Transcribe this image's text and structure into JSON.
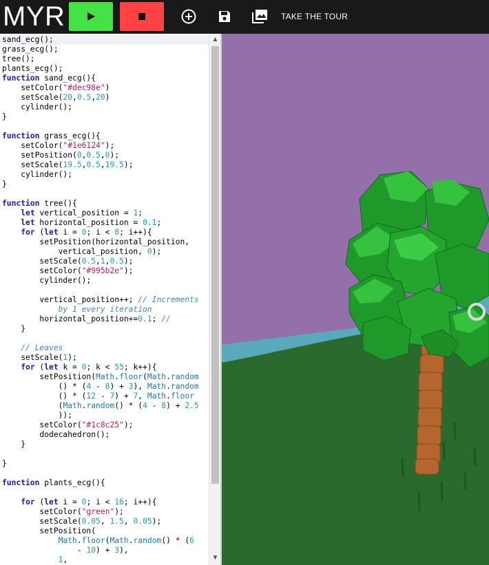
{
  "app": {
    "logo": "MYR"
  },
  "toolbar": {
    "run_icon": "play-icon",
    "stop_icon": "stop-icon",
    "add_icon": "add-circle-icon",
    "save_icon": "save-icon",
    "collection_icon": "photo-library-icon",
    "tour_label": "TAKE THE TOUR",
    "run_color": "#45e245",
    "stop_color": "#ff4242"
  },
  "editor": {
    "lines": [
      "sand_ecg();",
      "grass_ecg();",
      "tree();",
      "plants_ecg();",
      "function sand_ecg(){",
      "    setColor(\"#dec98e\")",
      "    setScale(20,0.5,20)",
      "    cylinder();",
      "}",
      "",
      "function grass_ecg(){",
      "    setColor(\"#1e6124\");",
      "    setPosition(0,0.5,0);",
      "    setScale(19.5,0.5,19.5);",
      "    cylinder();",
      "}",
      "",
      "function tree(){",
      "    let vertical_position = 1;",
      "    let horizontal_position = 0.1;",
      "    for (let i = 0; i < 8; i++){",
      "        setPosition(horizontal_position,",
      "            vertical_position, 0);",
      "        setScale(0.5,1,0.5);",
      "        setColor(\"#995b2e\");",
      "        cylinder();",
      "",
      "        vertical_position++; // Increments",
      "            by 1 every iteration",
      "        horizontal_position+=0.1; //",
      "    }",
      "",
      "    // Leaves",
      "    setScale(1);",
      "    for (let k = 0; k < 55; k++){",
      "        setPosition(Math.floor(Math.random",
      "            () * (4 - 8) + 3), Math.random",
      "            () * (12 - 7) + 7, Math.floor",
      "            (Math.random() * (4 - 8) + 2.5",
      "            ));",
      "        setColor(\"#1c8c25\");",
      "        dodecahedron();",
      "    }",
      "",
      "}",
      "",
      "function plants_ecg(){",
      "",
      "    for (let i = 0; i < 16; i++){",
      "        setColor(\"green\");",
      "        setScale(0.05, 1.5, 0.05);",
      "        setPosition(",
      "            Math.floor(Math.random() * (6",
      "                - 10) + 3),",
      "            1,"
    ]
  },
  "scene": {
    "sky_color": "#9470ab",
    "water_color": "#5aaabd",
    "grass_color": "#2b6a2d",
    "trunk_color": "#b5652e",
    "leaf_color": "#1f9a2a",
    "cursor_icon": "reticle-icon"
  }
}
